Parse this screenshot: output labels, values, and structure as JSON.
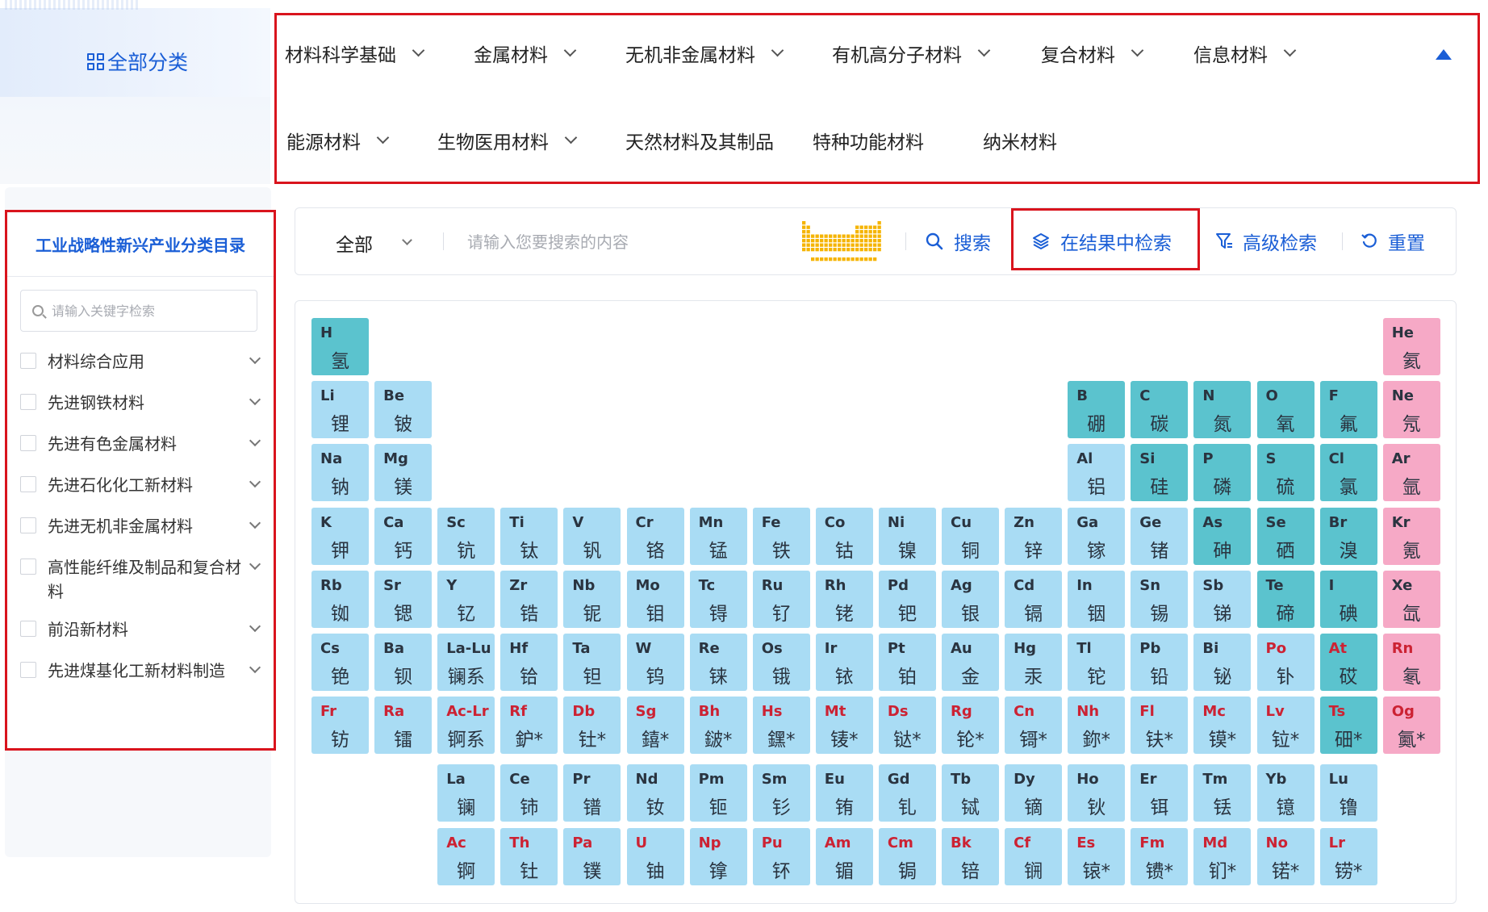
{
  "all_categories": {
    "label": "全部分类",
    "icon": "grid-icon"
  },
  "categories": [
    {
      "label": "材料科学基础",
      "has_dropdown": true
    },
    {
      "label": "金属材料",
      "has_dropdown": true
    },
    {
      "label": "无机非金属材料",
      "has_dropdown": true
    },
    {
      "label": "有机高分子材料",
      "has_dropdown": true
    },
    {
      "label": "复合材料",
      "has_dropdown": true
    },
    {
      "label": "信息材料",
      "has_dropdown": true
    },
    {
      "label": "能源材料",
      "has_dropdown": true
    },
    {
      "label": "生物医用材料",
      "has_dropdown": true
    },
    {
      "label": "天然材料及其制品",
      "has_dropdown": false
    },
    {
      "label": "特种功能材料",
      "has_dropdown": false
    },
    {
      "label": "纳米材料",
      "has_dropdown": false
    }
  ],
  "sidebar": {
    "title": "工业战略性新兴产业分类目录",
    "search_placeholder": "请输入关键字检索",
    "items": [
      {
        "label": "材料综合应用",
        "checked": false
      },
      {
        "label": "先进钢铁材料",
        "checked": false
      },
      {
        "label": "先进有色金属材料",
        "checked": false
      },
      {
        "label": "先进石化化工新材料",
        "checked": false
      },
      {
        "label": "先进无机非金属材料",
        "checked": false
      },
      {
        "label": "高性能纤维及制品和复合材料",
        "checked": false
      },
      {
        "label": "前沿新材料",
        "checked": false
      },
      {
        "label": "先进煤基化工新材料制造",
        "checked": false
      }
    ]
  },
  "search": {
    "scope": "全部",
    "placeholder": "请输入您要搜索的内容",
    "value": "",
    "search_label": "搜索",
    "in_result_label": "在结果中检索",
    "advanced_label": "高级检索",
    "reset_label": "重置"
  },
  "colors": {
    "accent": "#1a5ed6",
    "highlight_border": "#d9141d",
    "element_default": "#a9dcf4",
    "element_nonmetal": "#5bc3ce",
    "element_noble_gas": "#f6a9c6",
    "element_red_symbol": "#cc2233",
    "mini_table": "#f5b400"
  },
  "periodic_table": [
    [
      "H",
      "氢",
      1,
      1,
      "nm",
      0
    ],
    [
      "He",
      "氦",
      1,
      18,
      "ng",
      0
    ],
    [
      "Li",
      "锂",
      2,
      1,
      "d",
      0
    ],
    [
      "Be",
      "铍",
      2,
      2,
      "d",
      0
    ],
    [
      "B",
      "硼",
      2,
      13,
      "nm",
      0
    ],
    [
      "C",
      "碳",
      2,
      14,
      "nm",
      0
    ],
    [
      "N",
      "氮",
      2,
      15,
      "nm",
      0
    ],
    [
      "O",
      "氧",
      2,
      16,
      "nm",
      0
    ],
    [
      "F",
      "氟",
      2,
      17,
      "nm",
      0
    ],
    [
      "Ne",
      "氖",
      2,
      18,
      "ng",
      0
    ],
    [
      "Na",
      "钠",
      3,
      1,
      "d",
      0
    ],
    [
      "Mg",
      "镁",
      3,
      2,
      "d",
      0
    ],
    [
      "Al",
      "铝",
      3,
      13,
      "d",
      0
    ],
    [
      "Si",
      "硅",
      3,
      14,
      "nm",
      0
    ],
    [
      "P",
      "磷",
      3,
      15,
      "nm",
      0
    ],
    [
      "S",
      "硫",
      3,
      16,
      "nm",
      0
    ],
    [
      "Cl",
      "氯",
      3,
      17,
      "nm",
      0
    ],
    [
      "Ar",
      "氩",
      3,
      18,
      "ng",
      0
    ],
    [
      "K",
      "钾",
      4,
      1,
      "d",
      0
    ],
    [
      "Ca",
      "钙",
      4,
      2,
      "d",
      0
    ],
    [
      "Sc",
      "钪",
      4,
      3,
      "d",
      0
    ],
    [
      "Ti",
      "钛",
      4,
      4,
      "d",
      0
    ],
    [
      "V",
      "钒",
      4,
      5,
      "d",
      0
    ],
    [
      "Cr",
      "铬",
      4,
      6,
      "d",
      0
    ],
    [
      "Mn",
      "锰",
      4,
      7,
      "d",
      0
    ],
    [
      "Fe",
      "铁",
      4,
      8,
      "d",
      0
    ],
    [
      "Co",
      "钴",
      4,
      9,
      "d",
      0
    ],
    [
      "Ni",
      "镍",
      4,
      10,
      "d",
      0
    ],
    [
      "Cu",
      "铜",
      4,
      11,
      "d",
      0
    ],
    [
      "Zn",
      "锌",
      4,
      12,
      "d",
      0
    ],
    [
      "Ga",
      "镓",
      4,
      13,
      "d",
      0
    ],
    [
      "Ge",
      "锗",
      4,
      14,
      "d",
      0
    ],
    [
      "As",
      "砷",
      4,
      15,
      "nm",
      0
    ],
    [
      "Se",
      "硒",
      4,
      16,
      "nm",
      0
    ],
    [
      "Br",
      "溴",
      4,
      17,
      "nm",
      0
    ],
    [
      "Kr",
      "氪",
      4,
      18,
      "ng",
      0
    ],
    [
      "Rb",
      "铷",
      5,
      1,
      "d",
      0
    ],
    [
      "Sr",
      "锶",
      5,
      2,
      "d",
      0
    ],
    [
      "Y",
      "钇",
      5,
      3,
      "d",
      0
    ],
    [
      "Zr",
      "锆",
      5,
      4,
      "d",
      0
    ],
    [
      "Nb",
      "铌",
      5,
      5,
      "d",
      0
    ],
    [
      "Mo",
      "钼",
      5,
      6,
      "d",
      0
    ],
    [
      "Tc",
      "锝",
      5,
      7,
      "d",
      0
    ],
    [
      "Ru",
      "钌",
      5,
      8,
      "d",
      0
    ],
    [
      "Rh",
      "铑",
      5,
      9,
      "d",
      0
    ],
    [
      "Pd",
      "钯",
      5,
      10,
      "d",
      0
    ],
    [
      "Ag",
      "银",
      5,
      11,
      "d",
      0
    ],
    [
      "Cd",
      "镉",
      5,
      12,
      "d",
      0
    ],
    [
      "In",
      "铟",
      5,
      13,
      "d",
      0
    ],
    [
      "Sn",
      "锡",
      5,
      14,
      "d",
      0
    ],
    [
      "Sb",
      "锑",
      5,
      15,
      "d",
      0
    ],
    [
      "Te",
      "碲",
      5,
      16,
      "nm",
      0
    ],
    [
      "I",
      "碘",
      5,
      17,
      "nm",
      0
    ],
    [
      "Xe",
      "氙",
      5,
      18,
      "ng",
      0
    ],
    [
      "Cs",
      "铯",
      6,
      1,
      "d",
      0
    ],
    [
      "Ba",
      "钡",
      6,
      2,
      "d",
      0
    ],
    [
      "La-Lu",
      "镧系",
      6,
      3,
      "d",
      0
    ],
    [
      "Hf",
      "铪",
      6,
      4,
      "d",
      0
    ],
    [
      "Ta",
      "钽",
      6,
      5,
      "d",
      0
    ],
    [
      "W",
      "钨",
      6,
      6,
      "d",
      0
    ],
    [
      "Re",
      "铼",
      6,
      7,
      "d",
      0
    ],
    [
      "Os",
      "锇",
      6,
      8,
      "d",
      0
    ],
    [
      "Ir",
      "铱",
      6,
      9,
      "d",
      0
    ],
    [
      "Pt",
      "铂",
      6,
      10,
      "d",
      0
    ],
    [
      "Au",
      "金",
      6,
      11,
      "d",
      0
    ],
    [
      "Hg",
      "汞",
      6,
      12,
      "d",
      0
    ],
    [
      "Tl",
      "铊",
      6,
      13,
      "d",
      0
    ],
    [
      "Pb",
      "铅",
      6,
      14,
      "d",
      0
    ],
    [
      "Bi",
      "铋",
      6,
      15,
      "d",
      0
    ],
    [
      "Po",
      "钋",
      6,
      16,
      "d",
      1
    ],
    [
      "At",
      "砹",
      6,
      17,
      "nm",
      1
    ],
    [
      "Rn",
      "氡",
      6,
      18,
      "ng",
      1
    ],
    [
      "Fr",
      "钫",
      7,
      1,
      "d",
      1
    ],
    [
      "Ra",
      "镭",
      7,
      2,
      "d",
      1
    ],
    [
      "Ac-Lr",
      "锕系",
      7,
      3,
      "d",
      1
    ],
    [
      "Rf",
      "鈩*",
      7,
      4,
      "d",
      1
    ],
    [
      "Db",
      "钍*",
      7,
      5,
      "d",
      1
    ],
    [
      "Sg",
      "𨭎*",
      7,
      6,
      "d",
      1
    ],
    [
      "Bh",
      "𨨏*",
      7,
      7,
      "d",
      1
    ],
    [
      "Hs",
      "𨭆*",
      7,
      8,
      "d",
      1
    ],
    [
      "Mt",
      "鿏*",
      7,
      9,
      "d",
      1
    ],
    [
      "Ds",
      "𫟼*",
      7,
      10,
      "d",
      1
    ],
    [
      "Rg",
      "𬬭*",
      7,
      11,
      "d",
      1
    ],
    [
      "Cn",
      "鿔*",
      7,
      12,
      "d",
      1
    ],
    [
      "Nh",
      "鉨*",
      7,
      13,
      "d",
      1
    ],
    [
      "Fl",
      "𫓧*",
      7,
      14,
      "d",
      1
    ],
    [
      "Mc",
      "镆*",
      7,
      15,
      "d",
      1
    ],
    [
      "Lv",
      "𫟷*",
      7,
      16,
      "d",
      1
    ],
    [
      "Ts",
      "鿬*",
      7,
      17,
      "nm",
      1
    ],
    [
      "Og",
      "鿫*",
      7,
      18,
      "ng",
      1
    ],
    [
      "La",
      "镧",
      9,
      3,
      "d",
      0
    ],
    [
      "Ce",
      "铈",
      9,
      4,
      "d",
      0
    ],
    [
      "Pr",
      "镨",
      9,
      5,
      "d",
      0
    ],
    [
      "Nd",
      "钕",
      9,
      6,
      "d",
      0
    ],
    [
      "Pm",
      "钷",
      9,
      7,
      "d",
      0
    ],
    [
      "Sm",
      "钐",
      9,
      8,
      "d",
      0
    ],
    [
      "Eu",
      "铕",
      9,
      9,
      "d",
      0
    ],
    [
      "Gd",
      "钆",
      9,
      10,
      "d",
      0
    ],
    [
      "Tb",
      "铽",
      9,
      11,
      "d",
      0
    ],
    [
      "Dy",
      "镝",
      9,
      12,
      "d",
      0
    ],
    [
      "Ho",
      "钬",
      9,
      13,
      "d",
      0
    ],
    [
      "Er",
      "铒",
      9,
      14,
      "d",
      0
    ],
    [
      "Tm",
      "铥",
      9,
      15,
      "d",
      0
    ],
    [
      "Yb",
      "镱",
      9,
      16,
      "d",
      0
    ],
    [
      "Lu",
      "镥",
      9,
      17,
      "d",
      0
    ],
    [
      "Ac",
      "锕",
      10,
      3,
      "d",
      1
    ],
    [
      "Th",
      "钍",
      10,
      4,
      "d",
      1
    ],
    [
      "Pa",
      "镤",
      10,
      5,
      "d",
      1
    ],
    [
      "U",
      "铀",
      10,
      6,
      "d",
      1
    ],
    [
      "Np",
      "镎",
      10,
      7,
      "d",
      1
    ],
    [
      "Pu",
      "钚",
      10,
      8,
      "d",
      1
    ],
    [
      "Am",
      "镅",
      10,
      9,
      "d",
      1
    ],
    [
      "Cm",
      "锔",
      10,
      10,
      "d",
      1
    ],
    [
      "Bk",
      "锫",
      10,
      11,
      "d",
      1
    ],
    [
      "Cf",
      "锎",
      10,
      12,
      "d",
      1
    ],
    [
      "Es",
      "锿*",
      10,
      13,
      "d",
      1
    ],
    [
      "Fm",
      "镄*",
      10,
      14,
      "d",
      1
    ],
    [
      "Md",
      "钔*",
      10,
      15,
      "d",
      1
    ],
    [
      "No",
      "锘*",
      10,
      16,
      "d",
      1
    ],
    [
      "Lr",
      "铹*",
      10,
      17,
      "d",
      1
    ]
  ]
}
